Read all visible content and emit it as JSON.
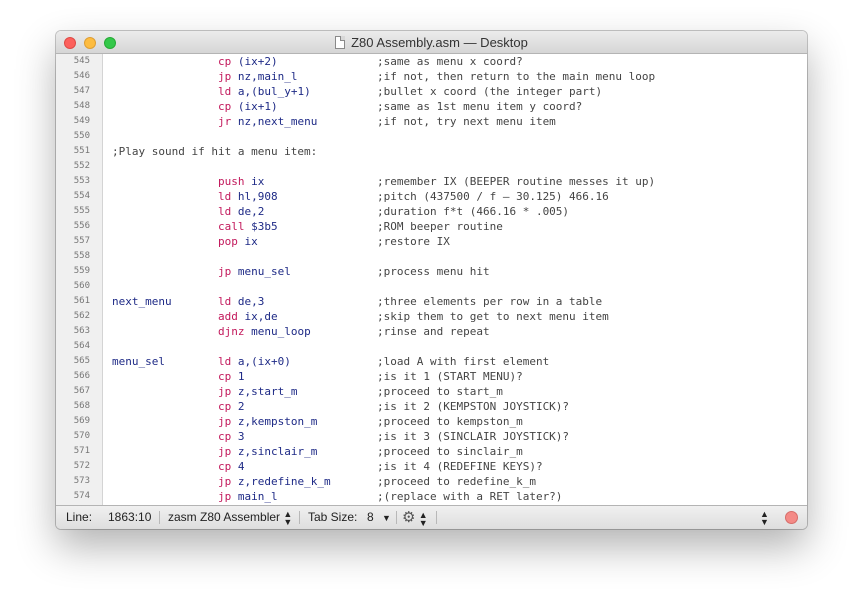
{
  "window": {
    "title": "Z80 Assembly.asm — Desktop"
  },
  "editor": {
    "lines": [
      {
        "num": "545",
        "label": "",
        "op": "cp",
        "args": "(ix+2)",
        "comment": ";same as menu x coord?"
      },
      {
        "num": "546",
        "label": "",
        "op": "jp",
        "args": "nz,main_l",
        "comment": ";if not, then return to the main menu loop"
      },
      {
        "num": "547",
        "label": "",
        "op": "ld",
        "args": "a,(bul_y+1)",
        "comment": ";bullet x coord (the integer part)"
      },
      {
        "num": "548",
        "label": "",
        "op": "cp",
        "args": "(ix+1)",
        "comment": ";same as 1st menu item y coord?"
      },
      {
        "num": "549",
        "label": "",
        "op": "jr",
        "args": "nz,next_menu",
        "comment": ";if not, try next menu item"
      },
      {
        "num": "550",
        "label": "",
        "op": "",
        "args": "",
        "comment": ""
      },
      {
        "num": "551",
        "label": "",
        "op": "",
        "args": "",
        "comment": "",
        "full_comment": ";Play sound if hit a menu item:"
      },
      {
        "num": "552",
        "label": "",
        "op": "",
        "args": "",
        "comment": ""
      },
      {
        "num": "553",
        "label": "",
        "op": "push",
        "args": "ix",
        "comment": ";remember IX (BEEPER routine messes it up)"
      },
      {
        "num": "554",
        "label": "",
        "op": "ld",
        "args": "hl,908",
        "comment": ";pitch (437500 / f – 30.125) 466.16"
      },
      {
        "num": "555",
        "label": "",
        "op": "ld",
        "args": "de,2",
        "comment": ";duration f*t (466.16 * .005)"
      },
      {
        "num": "556",
        "label": "",
        "op": "call",
        "args": "$3b5",
        "comment": ";ROM beeper routine"
      },
      {
        "num": "557",
        "label": "",
        "op": "pop",
        "args": "ix",
        "comment": ";restore IX"
      },
      {
        "num": "558",
        "label": "",
        "op": "",
        "args": "",
        "comment": ""
      },
      {
        "num": "559",
        "label": "",
        "op": "jp",
        "args": "menu_sel",
        "comment": ";process menu hit"
      },
      {
        "num": "560",
        "label": "",
        "op": "",
        "args": "",
        "comment": ""
      },
      {
        "num": "561",
        "label": "next_menu",
        "op": "ld",
        "args": "de,3",
        "comment": ";three elements per row in a table"
      },
      {
        "num": "562",
        "label": "",
        "op": "add",
        "args": "ix,de",
        "comment": ";skip them to get to next menu item"
      },
      {
        "num": "563",
        "label": "",
        "op": "djnz",
        "args": "menu_loop",
        "comment": ";rinse and repeat"
      },
      {
        "num": "564",
        "label": "",
        "op": "",
        "args": "",
        "comment": ""
      },
      {
        "num": "565",
        "label": "menu_sel",
        "op": "ld",
        "args": "a,(ix+0)",
        "comment": ";load A with first element"
      },
      {
        "num": "566",
        "label": "",
        "op": "cp",
        "args": "1",
        "comment": ";is it 1 (START MENU)?"
      },
      {
        "num": "567",
        "label": "",
        "op": "jp",
        "args": "z,start_m",
        "comment": ";proceed to start_m"
      },
      {
        "num": "568",
        "label": "",
        "op": "cp",
        "args": "2",
        "comment": ";is it 2 (KEMPSTON JOYSTICK)?"
      },
      {
        "num": "569",
        "label": "",
        "op": "jp",
        "args": "z,kempston_m",
        "comment": ";proceed to kempston_m"
      },
      {
        "num": "570",
        "label": "",
        "op": "cp",
        "args": "3",
        "comment": ";is it 3 (SINCLAIR JOYSTICK)?"
      },
      {
        "num": "571",
        "label": "",
        "op": "jp",
        "args": "z,sinclair_m",
        "comment": ";proceed to sinclair_m"
      },
      {
        "num": "572",
        "label": "",
        "op": "cp",
        "args": "4",
        "comment": ";is it 4 (REDEFINE KEYS)?"
      },
      {
        "num": "573",
        "label": "",
        "op": "jp",
        "args": "z,redefine_k_m",
        "comment": ";proceed to redefine_k_m"
      },
      {
        "num": "574",
        "label": "",
        "op": "jp",
        "args": "main_l",
        "comment": ";(replace with a RET later?)"
      }
    ]
  },
  "statusbar": {
    "line_label": "Line:",
    "line_value": "1863:10",
    "syntax": "zasm Z80 Assembler",
    "tab_label": "Tab Size:",
    "tab_value": "8"
  },
  "colors": {
    "opcode": "#c2185b",
    "operand": "#1e2a86",
    "label": "#1e2a86",
    "comment": "#444444"
  },
  "icons": [
    "document-icon",
    "gear-icon",
    "updown-chevron-icon",
    "chevron-down-icon",
    "close-dot-icon"
  ]
}
